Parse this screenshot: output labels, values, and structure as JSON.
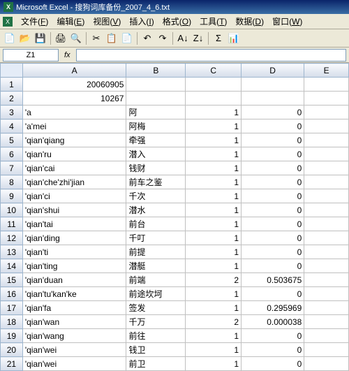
{
  "title_bar": {
    "app_icon_text": "X",
    "title": "Microsoft Excel - 搜狗词库备份_2007_4_6.txt"
  },
  "menu_bar": {
    "icon_text": "X",
    "items": [
      {
        "label": "文件",
        "hotkey": "F"
      },
      {
        "label": "编辑",
        "hotkey": "E"
      },
      {
        "label": "视图",
        "hotkey": "V"
      },
      {
        "label": "插入",
        "hotkey": "I"
      },
      {
        "label": "格式",
        "hotkey": "O"
      },
      {
        "label": "工具",
        "hotkey": "T"
      },
      {
        "label": "数据",
        "hotkey": "D"
      },
      {
        "label": "窗口",
        "hotkey": "W"
      }
    ]
  },
  "name_box": {
    "value": "Z1"
  },
  "fx": "fx",
  "columns": [
    "A",
    "B",
    "C",
    "D",
    "E"
  ],
  "rows": [
    {
      "n": 1,
      "a": "20060905",
      "a_num": true,
      "b": "",
      "c": "",
      "d": ""
    },
    {
      "n": 2,
      "a": "10267",
      "a_num": true,
      "b": "",
      "c": "",
      "d": ""
    },
    {
      "n": 3,
      "a": "'a",
      "b": "阿",
      "c": "1",
      "d": "0"
    },
    {
      "n": 4,
      "a": "'a'mei",
      "b": "阿梅",
      "c": "1",
      "d": "0"
    },
    {
      "n": 5,
      "a": "'qian'qiang",
      "b": "牵强",
      "c": "1",
      "d": "0"
    },
    {
      "n": 6,
      "a": "'qian'ru",
      "b": "潜入",
      "c": "1",
      "d": "0"
    },
    {
      "n": 7,
      "a": "'qian'cai",
      "b": "钱财",
      "c": "1",
      "d": "0"
    },
    {
      "n": 8,
      "a": "'qian'che'zhi'jian",
      "b": "前车之鉴",
      "c": "1",
      "d": "0"
    },
    {
      "n": 9,
      "a": "'qian'ci",
      "b": "千次",
      "c": "1",
      "d": "0"
    },
    {
      "n": 10,
      "a": "'qian'shui",
      "b": "潜水",
      "c": "1",
      "d": "0"
    },
    {
      "n": 11,
      "a": "'qian'tai",
      "b": "前台",
      "c": "1",
      "d": "0"
    },
    {
      "n": 12,
      "a": "'qian'ding",
      "b": "千叮",
      "c": "1",
      "d": "0"
    },
    {
      "n": 13,
      "a": "'qian'ti",
      "b": "前提",
      "c": "1",
      "d": "0"
    },
    {
      "n": 14,
      "a": "'qian'ting",
      "b": "潜艇",
      "c": "1",
      "d": "0"
    },
    {
      "n": 15,
      "a": "'qian'duan",
      "b": "前端",
      "c": "2",
      "d": "0.503675"
    },
    {
      "n": 16,
      "a": "'qian'tu'kan'ke",
      "b": "前途坎坷",
      "c": "1",
      "d": "0"
    },
    {
      "n": 17,
      "a": "'qian'fa",
      "b": "签发",
      "c": "1",
      "d": "0.295969"
    },
    {
      "n": 18,
      "a": "'qian'wan",
      "b": "千万",
      "c": "2",
      "d": "0.000038"
    },
    {
      "n": 19,
      "a": "'qian'wang",
      "b": "前往",
      "c": "1",
      "d": "0"
    },
    {
      "n": 20,
      "a": "'qian'wei",
      "b": "钱卫",
      "c": "1",
      "d": "0"
    },
    {
      "n": 21,
      "a": "'qian'wei",
      "b": "前卫",
      "c": "1",
      "d": "0"
    }
  ]
}
